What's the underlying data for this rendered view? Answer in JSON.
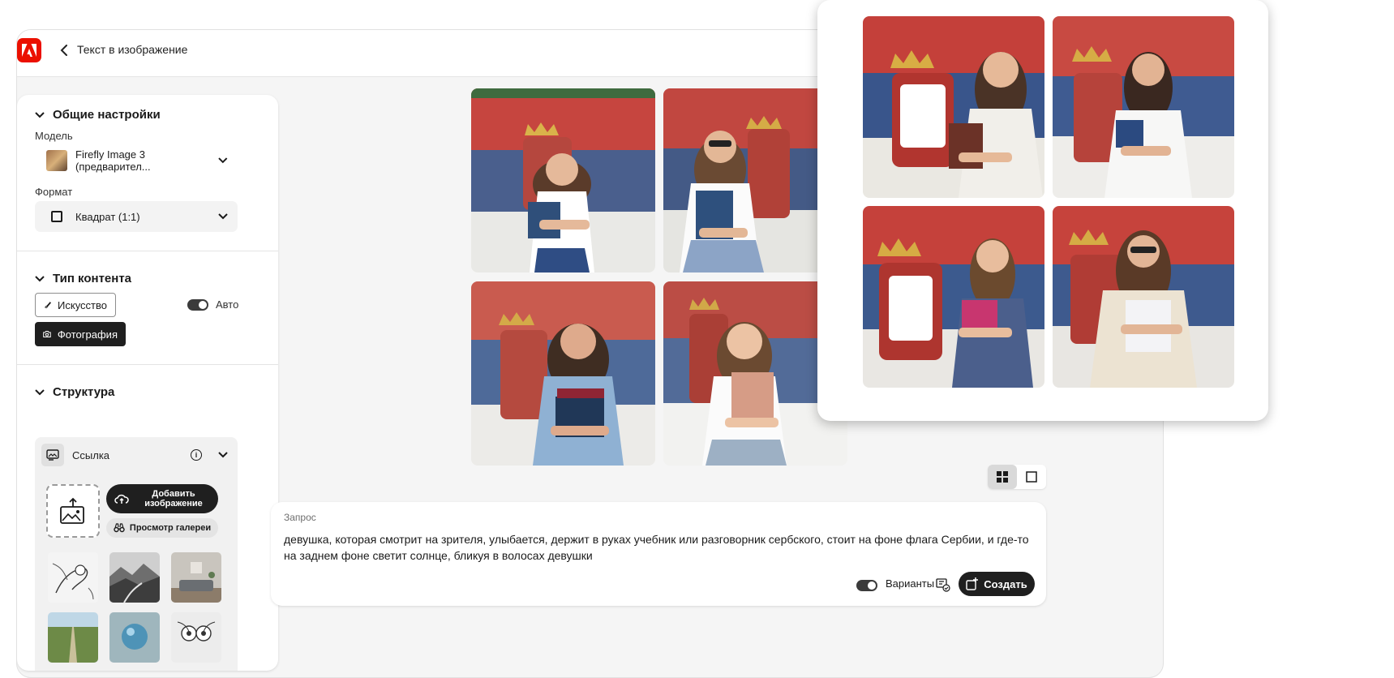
{
  "header": {
    "title": "Текст в изображение"
  },
  "sidebar": {
    "general": {
      "heading": "Общие настройки",
      "model_label": "Модель",
      "model_value": "Firefly Image 3 (предварител...",
      "format_label": "Формат",
      "format_value": "Квадрат (1:1)"
    },
    "content_type": {
      "heading": "Тип контента",
      "art_label": "Искусство",
      "photo_label": "Фотография",
      "auto_label": "Авто",
      "auto_on": true,
      "selected": "Фотография"
    },
    "structure": {
      "heading": "Структура",
      "reference_label": "Ссылка",
      "add_image_label": "Добавить изображение",
      "gallery_label": "Просмотр галереи"
    }
  },
  "prompt": {
    "label": "Запрос",
    "text": "девушка, которая смотрит на зрителя, улыбается, держит в руках учебник или разговорник сербского, стоит на фоне флага Сербии, и где-то на заднем фоне светит солнце, бликуя в волосах девушки",
    "variants_label": "Варианты",
    "variants_on": true,
    "create_label": "Создать"
  },
  "view": {
    "mode": "grid"
  },
  "colors": {
    "accent": "#eb1000",
    "dark_button": "#1f1f1f",
    "flag_red": "#c6363c",
    "flag_blue": "#0c4076",
    "flag_white": "#ffffff"
  }
}
